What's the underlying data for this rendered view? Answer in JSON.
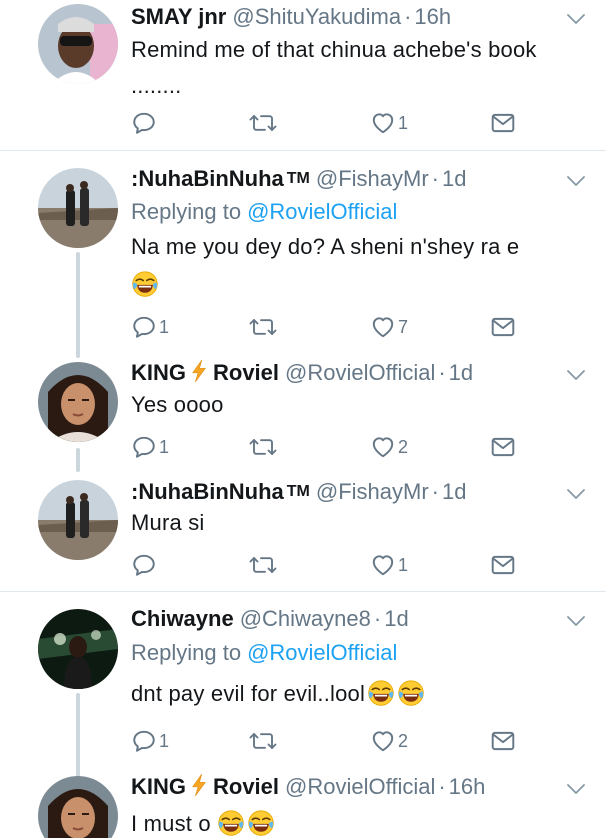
{
  "tweets": [
    {
      "name": "SMAY jnr",
      "handle": "@ShituYakudima",
      "time": "16h",
      "text_lines": [
        "Remind me of that chinua achebe's book",
        "........"
      ],
      "reply_count": "",
      "like_count": "1"
    },
    {
      "name": ":NuhaBinNuha",
      "tm": "TM",
      "handle": "@FishayMr",
      "time": "1d",
      "replying_label": "Replying to",
      "replying_to": "@RovielOfficial",
      "text": "Na me you dey do? A sheni n'shey ra e",
      "reply_count": "1",
      "like_count": "7"
    },
    {
      "name_part1": "KING",
      "name_part2": "Roviel",
      "handle": "@RovielOfficial",
      "time": "1d",
      "text": "Yes oooo",
      "reply_count": "1",
      "like_count": "2"
    },
    {
      "name": ":NuhaBinNuha",
      "tm": "TM",
      "handle": "@FishayMr",
      "time": "1d",
      "text": "Mura si",
      "reply_count": "",
      "like_count": "1"
    },
    {
      "name": "Chiwayne",
      "handle": "@Chiwayne8",
      "time": "1d",
      "replying_label": "Replying to",
      "replying_to": "@RovielOfficial",
      "text": "dnt pay evil for evil..lool",
      "reply_count": "1",
      "like_count": "2"
    },
    {
      "name_part1": "KING",
      "name_part2": "Roviel",
      "handle": "@RovielOfficial",
      "time": "16h",
      "text": "I must o"
    }
  ],
  "separator": "·",
  "emoji_name": "face-with-tears-of-joy",
  "colors": {
    "text": "#14171a",
    "secondary": "#657786",
    "link": "#1da1f2",
    "divider": "#e1e8ed",
    "thread_line": "#ccd6dd",
    "bolt": "#f5a623"
  }
}
